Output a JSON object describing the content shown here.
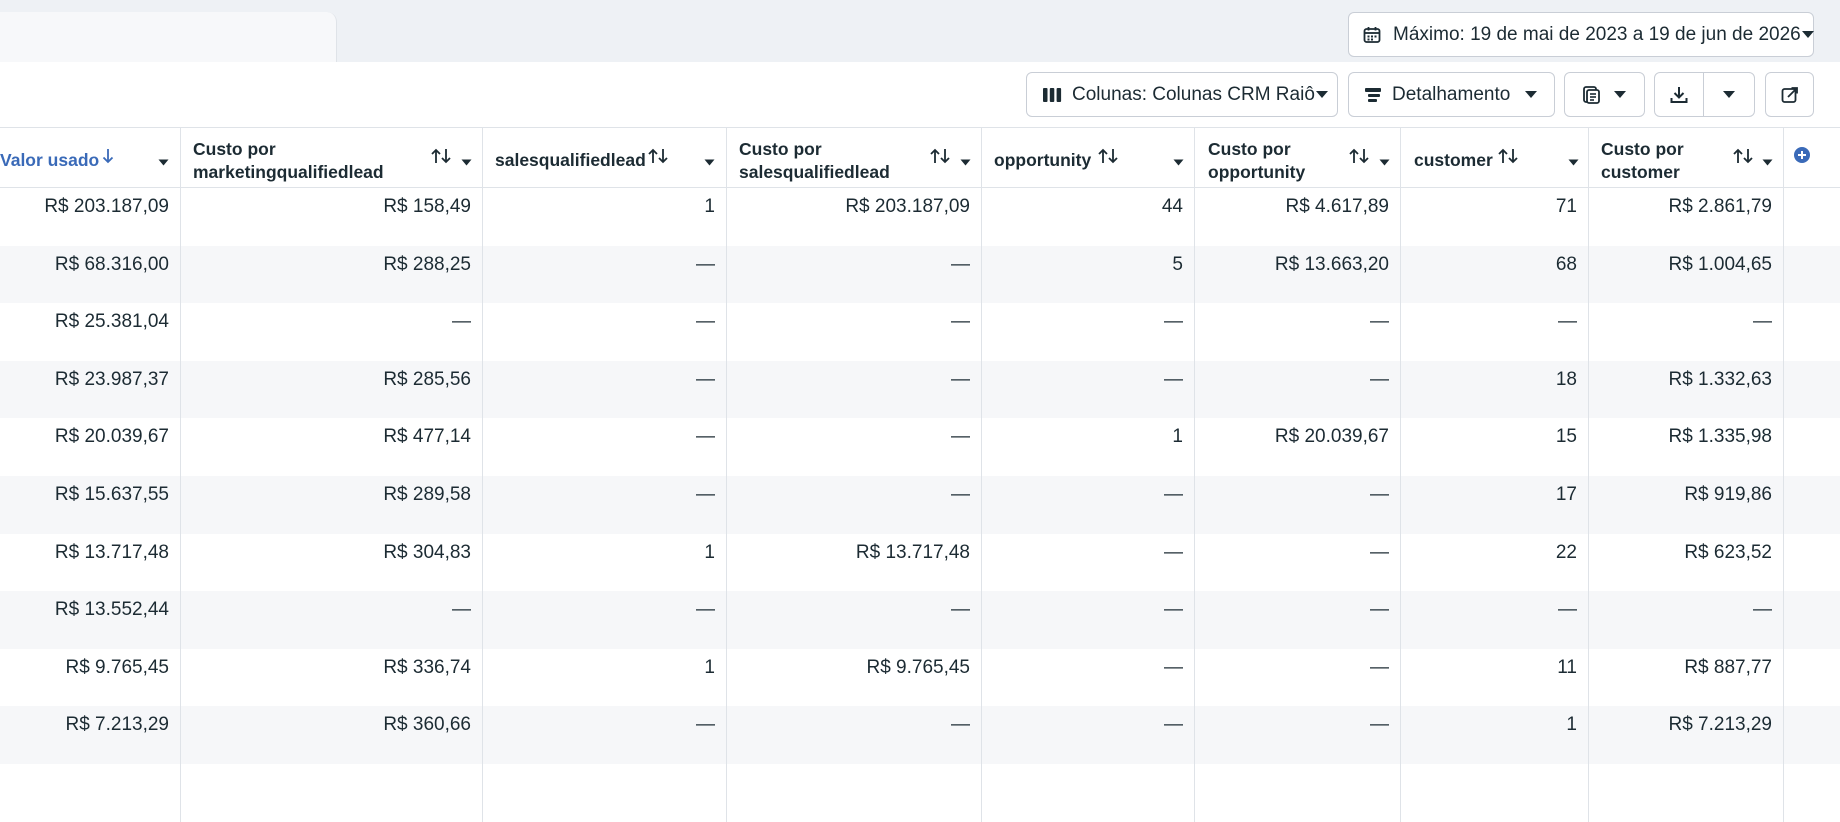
{
  "date_range": {
    "label": "Máximo: 19 de mai de 2023 a 19 de jun de 2026"
  },
  "toolbar": {
    "columns_label": "Colunas: Colunas CRM Raiô",
    "breakdown_label": "Detalhamento"
  },
  "table": {
    "columns": [
      {
        "key": "valor_usado",
        "lines": [
          "Valor usado"
        ]
      },
      {
        "key": "custo_mql",
        "lines": [
          "Custo por",
          "marketingqualifiedlead"
        ]
      },
      {
        "key": "sql",
        "lines": [
          "salesqualifiedlead"
        ]
      },
      {
        "key": "custo_sql",
        "lines": [
          "Custo por",
          "salesqualifiedlead"
        ]
      },
      {
        "key": "opportunity",
        "lines": [
          "opportunity"
        ]
      },
      {
        "key": "custo_opp",
        "lines": [
          "Custo por",
          "opportunity"
        ]
      },
      {
        "key": "customer",
        "lines": [
          "customer"
        ]
      },
      {
        "key": "custo_customer",
        "lines": [
          "Custo por",
          "customer"
        ]
      }
    ],
    "rows": [
      [
        "R$ 203.187,09",
        "R$ 158,49",
        "1",
        "R$ 203.187,09",
        "44",
        "R$ 4.617,89",
        "71",
        "R$ 2.861,79"
      ],
      [
        "R$ 68.316,00",
        "R$ 288,25",
        "—",
        "—",
        "5",
        "R$ 13.663,20",
        "68",
        "R$ 1.004,65"
      ],
      [
        "R$ 25.381,04",
        "—",
        "—",
        "—",
        "—",
        "—",
        "—",
        "—"
      ],
      [
        "R$ 23.987,37",
        "R$ 285,56",
        "—",
        "—",
        "—",
        "—",
        "18",
        "R$ 1.332,63"
      ],
      [
        "R$ 20.039,67",
        "R$ 477,14",
        "—",
        "—",
        "1",
        "R$ 20.039,67",
        "15",
        "R$ 1.335,98"
      ],
      [
        "R$ 15.637,55",
        "R$ 289,58",
        "—",
        "—",
        "—",
        "—",
        "17",
        "R$ 919,86"
      ],
      [
        "R$ 13.717,48",
        "R$ 304,83",
        "1",
        "R$ 13.717,48",
        "—",
        "—",
        "22",
        "R$ 623,52"
      ],
      [
        "R$ 13.552,44",
        "—",
        "—",
        "—",
        "—",
        "—",
        "—",
        "—"
      ],
      [
        "R$ 9.765,45",
        "R$ 336,74",
        "1",
        "R$ 9.765,45",
        "—",
        "—",
        "11",
        "R$ 887,77"
      ],
      [
        "R$ 7.213,29",
        "R$ 360,66",
        "—",
        "—",
        "—",
        "—",
        "1",
        "R$ 7.213,29"
      ],
      [
        "",
        "",
        "",
        "",
        "",
        "",
        "",
        ""
      ]
    ]
  },
  "icons": {
    "calendar": "calendar-icon",
    "columns": "columns-icon",
    "breakdown": "breakdown-icon",
    "reports": "reports-icon",
    "export": "download-icon",
    "share": "share-icon",
    "sort": "sort-icon",
    "sort_desc": "arrow-down-icon",
    "add_column": "plus-circle-icon"
  },
  "colors": {
    "accent": "#3a6ab8",
    "border": "#dfe3e8",
    "row_alt": "#f6f7f9"
  }
}
